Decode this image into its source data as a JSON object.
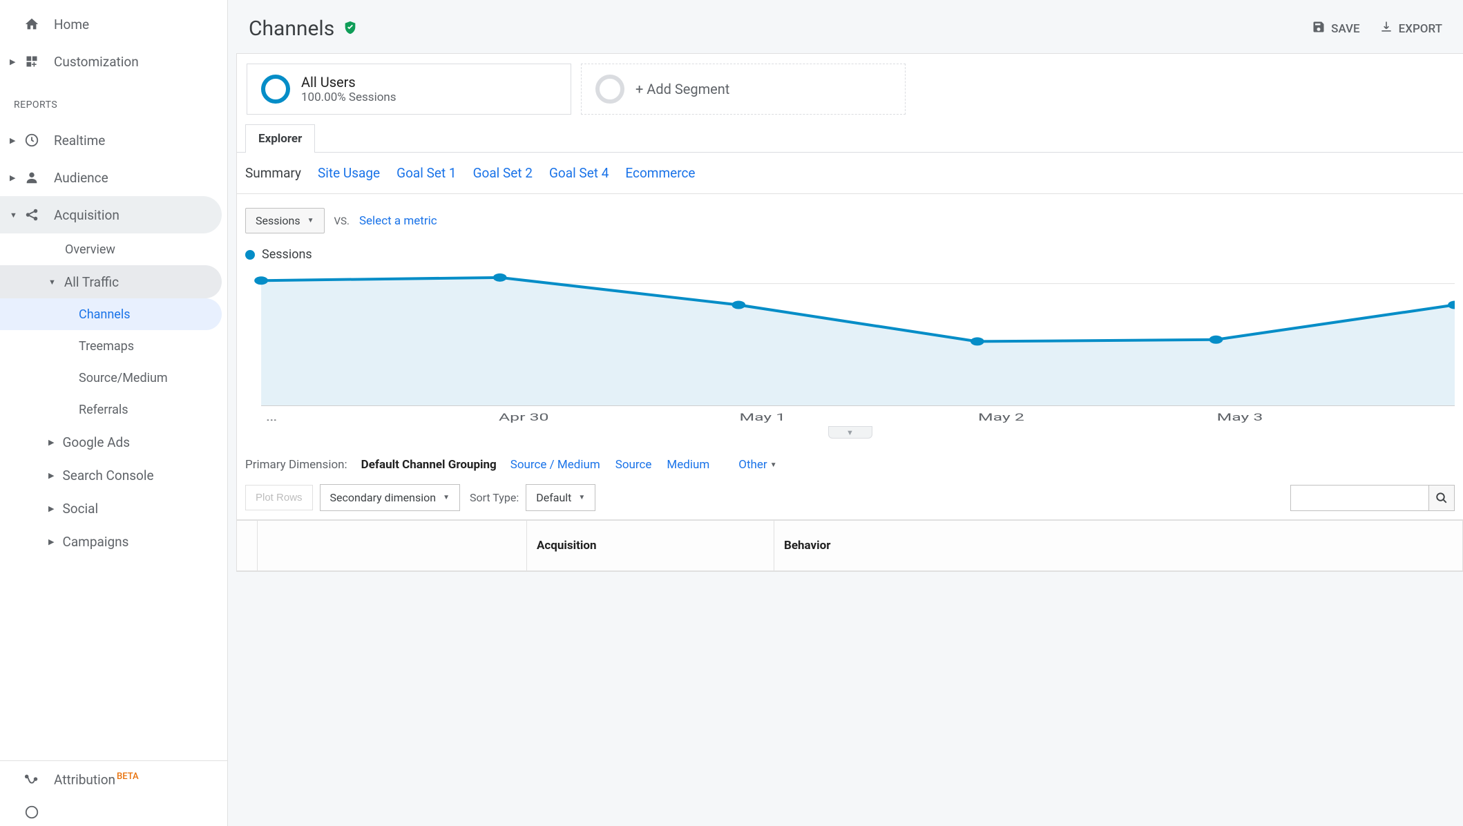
{
  "sidebar": {
    "home": "Home",
    "customization": "Customization",
    "reports_label": "REPORTS",
    "realtime": "Realtime",
    "audience": "Audience",
    "acquisition": "Acquisition",
    "acq_children": {
      "overview": "Overview",
      "all_traffic": "All Traffic",
      "channels": "Channels",
      "treemaps": "Treemaps",
      "source_medium": "Source/Medium",
      "referrals": "Referrals",
      "google_ads": "Google Ads",
      "search_console": "Search Console",
      "social": "Social",
      "campaigns": "Campaigns"
    },
    "attribution": "Attribution",
    "attribution_badge": "BETA"
  },
  "header": {
    "title": "Channels",
    "save": "SAVE",
    "export": "EXPORT"
  },
  "segments": {
    "all_users_title": "All Users",
    "all_users_sub": "100.00% Sessions",
    "add": "+ Add Segment",
    "circle_color": "#058dc7"
  },
  "tabs": {
    "explorer": "Explorer"
  },
  "sub_tabs": [
    "Summary",
    "Site Usage",
    "Goal Set 1",
    "Goal Set 2",
    "Goal Set 4",
    "Ecommerce"
  ],
  "metric": {
    "primary": "Sessions",
    "vs": "VS.",
    "select": "Select a metric",
    "legend": "Sessions"
  },
  "dimensions": {
    "label": "Primary Dimension:",
    "active": "Default Channel Grouping",
    "links": [
      "Source / Medium",
      "Source",
      "Medium"
    ],
    "other": "Other"
  },
  "controls": {
    "plot_rows": "Plot Rows",
    "secondary": "Secondary dimension",
    "sort_label": "Sort Type:",
    "sort_value": "Default"
  },
  "table": {
    "acquisition": "Acquisition",
    "behavior": "Behavior"
  },
  "chart_data": {
    "type": "line",
    "title": "",
    "xlabel": "",
    "ylabel": "Sessions",
    "ylim": [
      0,
      220
    ],
    "y_ticks": [
      100,
      200
    ],
    "x_labels": [
      "…",
      "Apr 30",
      "May 1",
      "May 2",
      "May 3"
    ],
    "series": [
      {
        "name": "Sessions",
        "color": "#058dc7",
        "values": [
          205,
          210,
          165,
          105,
          108,
          165
        ]
      }
    ]
  }
}
